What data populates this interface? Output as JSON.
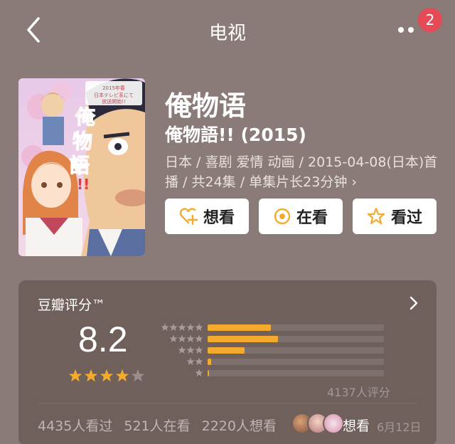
{
  "header": {
    "title": "电视",
    "notification_count": "2"
  },
  "poster": {
    "title_art": "俺物語!!",
    "banner": "2015年春 日本テレビ系にて 放送開始!!"
  },
  "subject": {
    "title": "俺物语",
    "original_title": "俺物語!! (2015)",
    "meta": "日本 / 喜剧 爱情 动画 / 2015-04-08(日本)首播 / 共24集 / 单集片长23分钟",
    "meta_more": "›"
  },
  "actions": [
    {
      "label": "想看",
      "icon": "heart-plus-icon"
    },
    {
      "label": "在看",
      "icon": "target-icon"
    },
    {
      "label": "看过",
      "icon": "star-outline-icon"
    }
  ],
  "rating": {
    "label": "豆瓣评分™",
    "score": "8.2",
    "stars_filled": 4,
    "stars_total": 5,
    "count_text": "4137人评分",
    "distribution": [
      {
        "stars": 5,
        "fraction": 0.36
      },
      {
        "stars": 4,
        "fraction": 0.4
      },
      {
        "stars": 3,
        "fraction": 0.21
      },
      {
        "stars": 2,
        "fraction": 0.02
      },
      {
        "stars": 1,
        "fraction": 0.01
      }
    ],
    "stats": {
      "watched": "4435人看过",
      "watching": "521人在看",
      "wanted": "2220人想看"
    },
    "friend_activity": {
      "action": "想看",
      "date": "6月12日"
    }
  },
  "colors": {
    "background": "#8b7b78",
    "card": "#6f605c",
    "accent": "#f4aa2c",
    "badge": "#e54a56"
  }
}
